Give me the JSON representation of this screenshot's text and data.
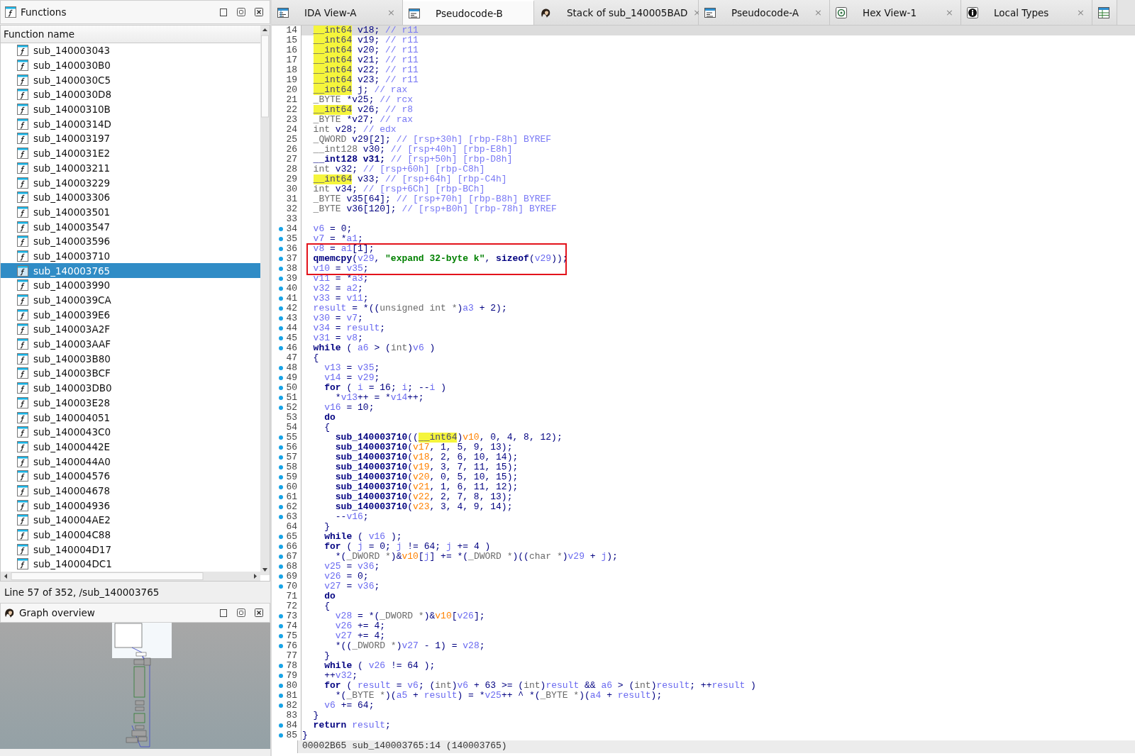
{
  "functions_panel": {
    "title": "Functions",
    "column": "Function name",
    "items": [
      {
        "name": "sub_140003043",
        "selected": false
      },
      {
        "name": "sub_1400030B0",
        "selected": false
      },
      {
        "name": "sub_1400030C5",
        "selected": false
      },
      {
        "name": "sub_1400030D8",
        "selected": false
      },
      {
        "name": "sub_14000310B",
        "selected": false
      },
      {
        "name": "sub_14000314D",
        "selected": false
      },
      {
        "name": "sub_140003197",
        "selected": false
      },
      {
        "name": "sub_1400031E2",
        "selected": false
      },
      {
        "name": "sub_140003211",
        "selected": false
      },
      {
        "name": "sub_140003229",
        "selected": false
      },
      {
        "name": "sub_140003306",
        "selected": false
      },
      {
        "name": "sub_140003501",
        "selected": false
      },
      {
        "name": "sub_140003547",
        "selected": false
      },
      {
        "name": "sub_140003596",
        "selected": false
      },
      {
        "name": "sub_140003710",
        "selected": false
      },
      {
        "name": "sub_140003765",
        "selected": true
      },
      {
        "name": "sub_140003990",
        "selected": false
      },
      {
        "name": "sub_1400039CA",
        "selected": false
      },
      {
        "name": "sub_1400039E6",
        "selected": false
      },
      {
        "name": "sub_140003A2F",
        "selected": false
      },
      {
        "name": "sub_140003AAF",
        "selected": false
      },
      {
        "name": "sub_140003B80",
        "selected": false
      },
      {
        "name": "sub_140003BCF",
        "selected": false
      },
      {
        "name": "sub_140003DB0",
        "selected": false
      },
      {
        "name": "sub_140003E28",
        "selected": false
      },
      {
        "name": "sub_140004051",
        "selected": false
      },
      {
        "name": "sub_1400043C0",
        "selected": false
      },
      {
        "name": "sub_14000442E",
        "selected": false
      },
      {
        "name": "sub_1400044A0",
        "selected": false
      },
      {
        "name": "sub_140004576",
        "selected": false
      },
      {
        "name": "sub_140004678",
        "selected": false
      },
      {
        "name": "sub_140004936",
        "selected": false
      },
      {
        "name": "sub_140004AE2",
        "selected": false
      },
      {
        "name": "sub_140004C88",
        "selected": false
      },
      {
        "name": "sub_140004D17",
        "selected": false
      },
      {
        "name": "sub_140004DC1",
        "selected": false
      }
    ],
    "status": "Line 57 of 352, /sub_140003765"
  },
  "graph_panel": {
    "title": "Graph overview"
  },
  "tabs": [
    {
      "kind": "disasm",
      "label": "IDA View-A",
      "selected": false,
      "close": "×"
    },
    {
      "kind": "pseudocode",
      "label": "Pseudocode-B",
      "selected": true
    },
    {
      "kind": "stack",
      "label": "Stack of sub_140005BAD",
      "selected": false,
      "close": "×"
    },
    {
      "kind": "pseudocode",
      "label": "Pseudocode-A",
      "selected": false,
      "close": "×"
    },
    {
      "kind": "hex",
      "label": "Hex View-1",
      "selected": false,
      "close": "×"
    },
    {
      "kind": "types",
      "label": "Local Types",
      "selected": false,
      "close": "×"
    },
    {
      "kind": "extra",
      "selected": false
    }
  ],
  "code": {
    "lines": [
      {
        "number": "14",
        "dot": false,
        "current": true,
        "boxed": false,
        "tokens": [
          {
            "kind": "hltype",
            "text": "  __int64"
          },
          {
            "kind": "plain",
            "text": " v18; "
          },
          {
            "kind": "comment",
            "text": "// r11"
          }
        ]
      },
      {
        "number": "15",
        "dot": false,
        "current": false,
        "boxed": false,
        "tokens": [
          {
            "kind": "hltype",
            "text": "  __int64"
          },
          {
            "kind": "plain",
            "text": " v19; "
          },
          {
            "kind": "comment",
            "text": "// r11"
          }
        ]
      },
      {
        "number": "16",
        "dot": false,
        "current": false,
        "boxed": false,
        "tokens": [
          {
            "kind": "hltype",
            "text": "  __int64"
          },
          {
            "kind": "plain",
            "text": " v20; "
          },
          {
            "kind": "comment",
            "text": "// r11"
          }
        ]
      },
      {
        "number": "17",
        "dot": false,
        "current": false,
        "boxed": false,
        "tokens": [
          {
            "kind": "hltype",
            "text": "  __int64"
          },
          {
            "kind": "plain",
            "text": " v21; "
          },
          {
            "kind": "comment",
            "text": "// r11"
          }
        ]
      },
      {
        "number": "18",
        "dot": false,
        "current": false,
        "boxed": false,
        "tokens": [
          {
            "kind": "hltype",
            "text": "  __int64"
          },
          {
            "kind": "plain",
            "text": " v22; "
          },
          {
            "kind": "comment",
            "text": "// r11"
          }
        ]
      },
      {
        "number": "19",
        "dot": false,
        "current": false,
        "boxed": false,
        "tokens": [
          {
            "kind": "hltype",
            "text": "  __int64"
          },
          {
            "kind": "plain",
            "text": " v23; "
          },
          {
            "kind": "comment",
            "text": "// r11"
          }
        ]
      },
      {
        "number": "20",
        "dot": false,
        "current": false,
        "boxed": false,
        "tokens": [
          {
            "kind": "hltype",
            "text": "  __int64"
          },
          {
            "kind": "plain",
            "text": " j; "
          },
          {
            "kind": "comment",
            "text": "// rax"
          }
        ]
      },
      {
        "number": "21",
        "dot": false,
        "current": false,
        "boxed": false,
        "tokens": [
          {
            "kind": "type",
            "text": "  _BYTE"
          },
          {
            "kind": "plain",
            "text": " *v25; "
          },
          {
            "kind": "comment",
            "text": "// rcx"
          }
        ]
      },
      {
        "number": "22",
        "dot": false,
        "current": false,
        "boxed": false,
        "tokens": [
          {
            "kind": "hltype",
            "text": "  __int64"
          },
          {
            "kind": "plain",
            "text": " v26; "
          },
          {
            "kind": "comment",
            "text": "// r8"
          }
        ]
      },
      {
        "number": "23",
        "dot": false,
        "current": false,
        "boxed": false,
        "tokens": [
          {
            "kind": "type",
            "text": "  _BYTE"
          },
          {
            "kind": "plain",
            "text": " *v27; "
          },
          {
            "kind": "comment",
            "text": "// rax"
          }
        ]
      },
      {
        "number": "24",
        "dot": false,
        "current": false,
        "boxed": false,
        "tokens": [
          {
            "kind": "type",
            "text": "  int"
          },
          {
            "kind": "plain",
            "text": " v28; "
          },
          {
            "kind": "comment",
            "text": "// edx"
          }
        ]
      },
      {
        "number": "25",
        "dot": false,
        "current": false,
        "boxed": false,
        "tokens": [
          {
            "kind": "type",
            "text": "  _QWORD"
          },
          {
            "kind": "plain",
            "text": " v29[2]; "
          },
          {
            "kind": "comment",
            "text": "// [rsp+30h] [rbp-F8h] BYREF"
          }
        ]
      },
      {
        "number": "26",
        "dot": false,
        "current": false,
        "boxed": false,
        "tokens": [
          {
            "kind": "type",
            "text": "  __int128"
          },
          {
            "kind": "plain",
            "text": " v30; "
          },
          {
            "kind": "comment",
            "text": "// [rsp+40h] [rbp-E8h]"
          }
        ]
      },
      {
        "number": "27",
        "dot": false,
        "current": false,
        "boxed": false,
        "tokens": [
          {
            "kind": "keyword",
            "text": "  __int128 v31;"
          },
          {
            "kind": "comment",
            "text": " // [rsp+50h] [rbp-D8h]"
          }
        ]
      },
      {
        "number": "28",
        "dot": false,
        "current": false,
        "boxed": false,
        "tokens": [
          {
            "kind": "type",
            "text": "  int"
          },
          {
            "kind": "plain",
            "text": " v32; "
          },
          {
            "kind": "comment",
            "text": "// [rsp+60h] [rbp-C8h]"
          }
        ]
      },
      {
        "number": "29",
        "dot": false,
        "current": false,
        "boxed": false,
        "tokens": [
          {
            "kind": "hltype",
            "text": "  __int64"
          },
          {
            "kind": "plain",
            "text": " v33; "
          },
          {
            "kind": "comment",
            "text": "// [rsp+64h] [rbp-C4h]"
          }
        ]
      },
      {
        "number": "30",
        "dot": false,
        "current": false,
        "boxed": false,
        "tokens": [
          {
            "kind": "type",
            "text": "  int"
          },
          {
            "kind": "plain",
            "text": " v34; "
          },
          {
            "kind": "comment",
            "text": "// [rsp+6Ch] [rbp-BCh]"
          }
        ]
      },
      {
        "number": "31",
        "dot": false,
        "current": false,
        "boxed": false,
        "tokens": [
          {
            "kind": "type",
            "text": "  _BYTE"
          },
          {
            "kind": "plain",
            "text": " v35[64]; "
          },
          {
            "kind": "comment",
            "text": "// [rsp+70h] [rbp-B8h] BYREF"
          }
        ]
      },
      {
        "number": "32",
        "dot": false,
        "current": false,
        "boxed": false,
        "tokens": [
          {
            "kind": "type",
            "text": "  _BYTE"
          },
          {
            "kind": "plain",
            "text": " v36[120]; "
          },
          {
            "kind": "comment",
            "text": "// [rsp+B0h] [rbp-78h] BYREF"
          }
        ]
      },
      {
        "number": "33",
        "dot": false,
        "current": false,
        "boxed": false
      },
      {
        "number": "34",
        "dot": true,
        "current": false,
        "boxed": false,
        "tokens": [
          {
            "kind": "var",
            "text": "  v6"
          },
          {
            "kind": "plain",
            "text": " = 0;"
          }
        ]
      },
      {
        "number": "35",
        "dot": true,
        "current": false,
        "boxed": false,
        "tokens": [
          {
            "kind": "var",
            "text": "  v7"
          },
          {
            "kind": "plain",
            "text": " = *"
          },
          {
            "kind": "var",
            "text": "a1"
          },
          {
            "kind": "plain",
            "text": ";"
          }
        ]
      },
      {
        "number": "36",
        "dot": true,
        "current": false,
        "boxed": true,
        "tokens": [
          {
            "kind": "var",
            "text": "  v8"
          },
          {
            "kind": "plain",
            "text": " = "
          },
          {
            "kind": "var",
            "text": "a1"
          },
          {
            "kind": "plain",
            "text": "[1];"
          }
        ]
      },
      {
        "number": "37",
        "dot": true,
        "current": false,
        "boxed": true,
        "tokens": [
          {
            "kind": "func",
            "text": "  qmemcpy"
          },
          {
            "kind": "plain",
            "text": "("
          },
          {
            "kind": "var",
            "text": "v29"
          },
          {
            "kind": "plain",
            "text": ", "
          },
          {
            "kind": "string",
            "text": "\"expand 32-byte k\""
          },
          {
            "kind": "plain",
            "text": ", "
          },
          {
            "kind": "keyword",
            "text": "sizeof"
          },
          {
            "kind": "plain",
            "text": "("
          },
          {
            "kind": "var",
            "text": "v29"
          },
          {
            "kind": "plain",
            "text": "));"
          }
        ]
      },
      {
        "number": "38",
        "dot": true,
        "current": false,
        "boxed": true,
        "tokens": [
          {
            "kind": "var",
            "text": "  v10"
          },
          {
            "kind": "plain",
            "text": " = "
          },
          {
            "kind": "var",
            "text": "v35"
          },
          {
            "kind": "plain",
            "text": ";"
          }
        ]
      },
      {
        "number": "39",
        "dot": true,
        "current": false,
        "boxed": false,
        "tokens": [
          {
            "kind": "var",
            "text": "  v11"
          },
          {
            "kind": "plain",
            "text": " = *"
          },
          {
            "kind": "var",
            "text": "a3"
          },
          {
            "kind": "plain",
            "text": ";"
          }
        ]
      },
      {
        "number": "40",
        "dot": true,
        "current": false,
        "boxed": false,
        "tokens": [
          {
            "kind": "var",
            "text": "  v32"
          },
          {
            "kind": "plain",
            "text": " = "
          },
          {
            "kind": "var",
            "text": "a2"
          },
          {
            "kind": "plain",
            "text": ";"
          }
        ]
      },
      {
        "number": "41",
        "dot": true,
        "current": false,
        "boxed": false,
        "tokens": [
          {
            "kind": "var",
            "text": "  v33"
          },
          {
            "kind": "plain",
            "text": " = "
          },
          {
            "kind": "var",
            "text": "v11"
          },
          {
            "kind": "plain",
            "text": ";"
          }
        ]
      },
      {
        "number": "42",
        "dot": true,
        "current": false,
        "boxed": false,
        "tokens": [
          {
            "kind": "var",
            "text": "  result"
          },
          {
            "kind": "plain",
            "text": " = *(("
          },
          {
            "kind": "type",
            "text": "unsigned int *"
          },
          {
            "kind": "plain",
            "text": ")"
          },
          {
            "kind": "var",
            "text": "a3"
          },
          {
            "kind": "plain",
            "text": " + 2);"
          }
        ]
      },
      {
        "number": "43",
        "dot": true,
        "current": false,
        "boxed": false,
        "tokens": [
          {
            "kind": "var",
            "text": "  v30"
          },
          {
            "kind": "plain",
            "text": " = "
          },
          {
            "kind": "var",
            "text": "v7"
          },
          {
            "kind": "plain",
            "text": ";"
          }
        ]
      },
      {
        "number": "44",
        "dot": true,
        "current": false,
        "boxed": false,
        "tokens": [
          {
            "kind": "var",
            "text": "  v34"
          },
          {
            "kind": "plain",
            "text": " = "
          },
          {
            "kind": "var",
            "text": "result"
          },
          {
            "kind": "plain",
            "text": ";"
          }
        ]
      },
      {
        "number": "45",
        "dot": true,
        "current": false,
        "boxed": false,
        "tokens": [
          {
            "kind": "var",
            "text": "  v31"
          },
          {
            "kind": "plain",
            "text": " = "
          },
          {
            "kind": "var",
            "text": "v8"
          },
          {
            "kind": "plain",
            "text": ";"
          }
        ]
      },
      {
        "number": "46",
        "dot": true,
        "current": false,
        "boxed": false,
        "tokens": [
          {
            "kind": "keyword",
            "text": "  while"
          },
          {
            "kind": "plain",
            "text": " ( "
          },
          {
            "kind": "var",
            "text": "a6"
          },
          {
            "kind": "plain",
            "text": " > ("
          },
          {
            "kind": "type",
            "text": "int"
          },
          {
            "kind": "plain",
            "text": ")"
          },
          {
            "kind": "var",
            "text": "v6"
          },
          {
            "kind": "plain",
            "text": " )"
          }
        ]
      },
      {
        "number": "47",
        "dot": false,
        "current": false,
        "boxed": false,
        "tokens": [
          {
            "kind": "plain",
            "text": "  {"
          }
        ]
      },
      {
        "number": "48",
        "dot": true,
        "current": false,
        "boxed": false,
        "tokens": [
          {
            "kind": "var",
            "text": "    v13"
          },
          {
            "kind": "plain",
            "text": " = "
          },
          {
            "kind": "var",
            "text": "v35"
          },
          {
            "kind": "plain",
            "text": ";"
          }
        ]
      },
      {
        "number": "49",
        "dot": true,
        "current": false,
        "boxed": false,
        "tokens": [
          {
            "kind": "var",
            "text": "    v14"
          },
          {
            "kind": "plain",
            "text": " = "
          },
          {
            "kind": "var",
            "text": "v29"
          },
          {
            "kind": "plain",
            "text": ";"
          }
        ]
      },
      {
        "number": "50",
        "dot": true,
        "current": false,
        "boxed": false,
        "tokens": [
          {
            "kind": "keyword",
            "text": "    for"
          },
          {
            "kind": "plain",
            "text": " ( "
          },
          {
            "kind": "var",
            "text": "i"
          },
          {
            "kind": "plain",
            "text": " = 16; "
          },
          {
            "kind": "var",
            "text": "i"
          },
          {
            "kind": "plain",
            "text": "; --"
          },
          {
            "kind": "var",
            "text": "i"
          },
          {
            "kind": "plain",
            "text": " )"
          }
        ]
      },
      {
        "number": "51",
        "dot": true,
        "current": false,
        "boxed": false,
        "tokens": [
          {
            "kind": "plain",
            "text": "      *"
          },
          {
            "kind": "var",
            "text": "v13"
          },
          {
            "kind": "plain",
            "text": "++ = *"
          },
          {
            "kind": "var",
            "text": "v14"
          },
          {
            "kind": "plain",
            "text": "++;"
          }
        ]
      },
      {
        "number": "52",
        "dot": true,
        "current": false,
        "boxed": false,
        "tokens": [
          {
            "kind": "var",
            "text": "    v16"
          },
          {
            "kind": "plain",
            "text": " = 10;"
          }
        ]
      },
      {
        "number": "53",
        "dot": false,
        "current": false,
        "boxed": false,
        "tokens": [
          {
            "kind": "keyword",
            "text": "    do"
          }
        ]
      },
      {
        "number": "54",
        "dot": false,
        "current": false,
        "boxed": false,
        "tokens": [
          {
            "kind": "plain",
            "text": "    {"
          }
        ]
      },
      {
        "number": "55",
        "dot": true,
        "current": false,
        "boxed": false,
        "tokens": [
          {
            "kind": "func",
            "text": "      sub_140003710"
          },
          {
            "kind": "plain",
            "text": "(("
          },
          {
            "kind": "hltype",
            "text": "__int64"
          },
          {
            "kind": "plain",
            "text": ")"
          },
          {
            "kind": "arg",
            "text": "v10"
          },
          {
            "kind": "plain",
            "text": ", 0, 4, 8, 12);"
          }
        ]
      },
      {
        "number": "56",
        "dot": true,
        "current": false,
        "boxed": false,
        "tokens": [
          {
            "kind": "func",
            "text": "      sub_140003710"
          },
          {
            "kind": "plain",
            "text": "("
          },
          {
            "kind": "arg",
            "text": "v17"
          },
          {
            "kind": "plain",
            "text": ", 1, 5, 9, 13);"
          }
        ]
      },
      {
        "number": "57",
        "dot": true,
        "current": false,
        "boxed": false,
        "tokens": [
          {
            "kind": "func",
            "text": "      sub_140003710"
          },
          {
            "kind": "plain",
            "text": "("
          },
          {
            "kind": "arg",
            "text": "v18"
          },
          {
            "kind": "plain",
            "text": ", 2, 6, 10, 14);"
          }
        ]
      },
      {
        "number": "58",
        "dot": true,
        "current": false,
        "boxed": false,
        "tokens": [
          {
            "kind": "func",
            "text": "      sub_140003710"
          },
          {
            "kind": "plain",
            "text": "("
          },
          {
            "kind": "arg",
            "text": "v19"
          },
          {
            "kind": "plain",
            "text": ", 3, 7, 11, 15);"
          }
        ]
      },
      {
        "number": "59",
        "dot": true,
        "current": false,
        "boxed": false,
        "tokens": [
          {
            "kind": "func",
            "text": "      sub_140003710"
          },
          {
            "kind": "plain",
            "text": "("
          },
          {
            "kind": "arg",
            "text": "v20"
          },
          {
            "kind": "plain",
            "text": ", 0, 5, 10, 15);"
          }
        ]
      },
      {
        "number": "60",
        "dot": true,
        "current": false,
        "boxed": false,
        "tokens": [
          {
            "kind": "func",
            "text": "      sub_140003710"
          },
          {
            "kind": "plain",
            "text": "("
          },
          {
            "kind": "arg",
            "text": "v21"
          },
          {
            "kind": "plain",
            "text": ", 1, 6, 11, 12);"
          }
        ]
      },
      {
        "number": "61",
        "dot": true,
        "current": false,
        "boxed": false,
        "tokens": [
          {
            "kind": "func",
            "text": "      sub_140003710"
          },
          {
            "kind": "plain",
            "text": "("
          },
          {
            "kind": "arg",
            "text": "v22"
          },
          {
            "kind": "plain",
            "text": ", 2, 7, 8, 13);"
          }
        ]
      },
      {
        "number": "62",
        "dot": true,
        "current": false,
        "boxed": false,
        "tokens": [
          {
            "kind": "func",
            "text": "      sub_140003710"
          },
          {
            "kind": "plain",
            "text": "("
          },
          {
            "kind": "arg",
            "text": "v23"
          },
          {
            "kind": "plain",
            "text": ", 3, 4, 9, 14);"
          }
        ]
      },
      {
        "number": "63",
        "dot": true,
        "current": false,
        "boxed": false,
        "tokens": [
          {
            "kind": "plain",
            "text": "      --"
          },
          {
            "kind": "var",
            "text": "v16"
          },
          {
            "kind": "plain",
            "text": ";"
          }
        ]
      },
      {
        "number": "64",
        "dot": false,
        "current": false,
        "boxed": false,
        "tokens": [
          {
            "kind": "plain",
            "text": "    }"
          }
        ]
      },
      {
        "number": "65",
        "dot": true,
        "current": false,
        "boxed": false,
        "tokens": [
          {
            "kind": "keyword",
            "text": "    while"
          },
          {
            "kind": "plain",
            "text": " ( "
          },
          {
            "kind": "var",
            "text": "v16"
          },
          {
            "kind": "plain",
            "text": " );"
          }
        ]
      },
      {
        "number": "66",
        "dot": true,
        "current": false,
        "boxed": false,
        "tokens": [
          {
            "kind": "keyword",
            "text": "    for"
          },
          {
            "kind": "plain",
            "text": " ( "
          },
          {
            "kind": "var",
            "text": "j"
          },
          {
            "kind": "plain",
            "text": " = 0; "
          },
          {
            "kind": "var",
            "text": "j"
          },
          {
            "kind": "plain",
            "text": " != 64; "
          },
          {
            "kind": "var",
            "text": "j"
          },
          {
            "kind": "plain",
            "text": " += 4 )"
          }
        ]
      },
      {
        "number": "67",
        "dot": true,
        "current": false,
        "boxed": false,
        "tokens": [
          {
            "kind": "plain",
            "text": "      *("
          },
          {
            "kind": "type",
            "text": "_DWORD *"
          },
          {
            "kind": "plain",
            "text": ")&"
          },
          {
            "kind": "arg",
            "text": "v10"
          },
          {
            "kind": "plain",
            "text": "["
          },
          {
            "kind": "var",
            "text": "j"
          },
          {
            "kind": "plain",
            "text": "] += *("
          },
          {
            "kind": "type",
            "text": "_DWORD *"
          },
          {
            "kind": "plain",
            "text": ")(("
          },
          {
            "kind": "type",
            "text": "char *"
          },
          {
            "kind": "plain",
            "text": ")"
          },
          {
            "kind": "var",
            "text": "v29"
          },
          {
            "kind": "plain",
            "text": " + "
          },
          {
            "kind": "var",
            "text": "j"
          },
          {
            "kind": "plain",
            "text": ");"
          }
        ]
      },
      {
        "number": "68",
        "dot": true,
        "current": false,
        "boxed": false,
        "tokens": [
          {
            "kind": "var",
            "text": "    v25"
          },
          {
            "kind": "plain",
            "text": " = "
          },
          {
            "kind": "var",
            "text": "v36"
          },
          {
            "kind": "plain",
            "text": ";"
          }
        ]
      },
      {
        "number": "69",
        "dot": true,
        "current": false,
        "boxed": false,
        "tokens": [
          {
            "kind": "var",
            "text": "    v26"
          },
          {
            "kind": "plain",
            "text": " = 0;"
          }
        ]
      },
      {
        "number": "70",
        "dot": true,
        "current": false,
        "boxed": false,
        "tokens": [
          {
            "kind": "var",
            "text": "    v27"
          },
          {
            "kind": "plain",
            "text": " = "
          },
          {
            "kind": "var",
            "text": "v36"
          },
          {
            "kind": "plain",
            "text": ";"
          }
        ]
      },
      {
        "number": "71",
        "dot": false,
        "current": false,
        "boxed": false,
        "tokens": [
          {
            "kind": "keyword",
            "text": "    do"
          }
        ]
      },
      {
        "number": "72",
        "dot": false,
        "current": false,
        "boxed": false,
        "tokens": [
          {
            "kind": "plain",
            "text": "    {"
          }
        ]
      },
      {
        "number": "73",
        "dot": true,
        "current": false,
        "boxed": false,
        "tokens": [
          {
            "kind": "var",
            "text": "      v28"
          },
          {
            "kind": "plain",
            "text": " = *("
          },
          {
            "kind": "type",
            "text": "_DWORD *"
          },
          {
            "kind": "plain",
            "text": ")&"
          },
          {
            "kind": "arg",
            "text": "v10"
          },
          {
            "kind": "plain",
            "text": "["
          },
          {
            "kind": "var",
            "text": "v26"
          },
          {
            "kind": "plain",
            "text": "];"
          }
        ]
      },
      {
        "number": "74",
        "dot": true,
        "current": false,
        "boxed": false,
        "tokens": [
          {
            "kind": "var",
            "text": "      v26"
          },
          {
            "kind": "plain",
            "text": " += 4;"
          }
        ]
      },
      {
        "number": "75",
        "dot": true,
        "current": false,
        "boxed": false,
        "tokens": [
          {
            "kind": "var",
            "text": "      v27"
          },
          {
            "kind": "plain",
            "text": " += 4;"
          }
        ]
      },
      {
        "number": "76",
        "dot": true,
        "current": false,
        "boxed": false,
        "tokens": [
          {
            "kind": "plain",
            "text": "      *(("
          },
          {
            "kind": "type",
            "text": "_DWORD *"
          },
          {
            "kind": "plain",
            "text": ")"
          },
          {
            "kind": "var",
            "text": "v27"
          },
          {
            "kind": "plain",
            "text": " - 1) = "
          },
          {
            "kind": "var",
            "text": "v28"
          },
          {
            "kind": "plain",
            "text": ";"
          }
        ]
      },
      {
        "number": "77",
        "dot": false,
        "current": false,
        "boxed": false,
        "tokens": [
          {
            "kind": "plain",
            "text": "    }"
          }
        ]
      },
      {
        "number": "78",
        "dot": true,
        "current": false,
        "boxed": false,
        "tokens": [
          {
            "kind": "keyword",
            "text": "    while"
          },
          {
            "kind": "plain",
            "text": " ( "
          },
          {
            "kind": "var",
            "text": "v26"
          },
          {
            "kind": "plain",
            "text": " != 64 );"
          }
        ]
      },
      {
        "number": "79",
        "dot": true,
        "current": false,
        "boxed": false,
        "tokens": [
          {
            "kind": "plain",
            "text": "    ++"
          },
          {
            "kind": "var",
            "text": "v32"
          },
          {
            "kind": "plain",
            "text": ";"
          }
        ]
      },
      {
        "number": "80",
        "dot": true,
        "current": false,
        "boxed": false,
        "tokens": [
          {
            "kind": "keyword",
            "text": "    for"
          },
          {
            "kind": "plain",
            "text": " ( "
          },
          {
            "kind": "var",
            "text": "result"
          },
          {
            "kind": "plain",
            "text": " = "
          },
          {
            "kind": "var",
            "text": "v6"
          },
          {
            "kind": "plain",
            "text": "; ("
          },
          {
            "kind": "type",
            "text": "int"
          },
          {
            "kind": "plain",
            "text": ")"
          },
          {
            "kind": "var",
            "text": "v6"
          },
          {
            "kind": "plain",
            "text": " + 63 >= ("
          },
          {
            "kind": "type",
            "text": "int"
          },
          {
            "kind": "plain",
            "text": ")"
          },
          {
            "kind": "var",
            "text": "result"
          },
          {
            "kind": "plain",
            "text": " && "
          },
          {
            "kind": "var",
            "text": "a6"
          },
          {
            "kind": "plain",
            "text": " > ("
          },
          {
            "kind": "type",
            "text": "int"
          },
          {
            "kind": "plain",
            "text": ")"
          },
          {
            "kind": "var",
            "text": "result"
          },
          {
            "kind": "plain",
            "text": "; ++"
          },
          {
            "kind": "var",
            "text": "result"
          },
          {
            "kind": "plain",
            "text": " )"
          }
        ]
      },
      {
        "number": "81",
        "dot": true,
        "current": false,
        "boxed": false,
        "tokens": [
          {
            "kind": "plain",
            "text": "      *("
          },
          {
            "kind": "type",
            "text": "_BYTE *"
          },
          {
            "kind": "plain",
            "text": ")("
          },
          {
            "kind": "var",
            "text": "a5"
          },
          {
            "kind": "plain",
            "text": " + "
          },
          {
            "kind": "var",
            "text": "result"
          },
          {
            "kind": "plain",
            "text": ") = *"
          },
          {
            "kind": "var",
            "text": "v25"
          },
          {
            "kind": "plain",
            "text": "++ ^ *("
          },
          {
            "kind": "type",
            "text": "_BYTE *"
          },
          {
            "kind": "plain",
            "text": ")("
          },
          {
            "kind": "var",
            "text": "a4"
          },
          {
            "kind": "plain",
            "text": " + "
          },
          {
            "kind": "var",
            "text": "result"
          },
          {
            "kind": "plain",
            "text": ");"
          }
        ]
      },
      {
        "number": "82",
        "dot": true,
        "current": false,
        "boxed": false,
        "tokens": [
          {
            "kind": "var",
            "text": "    v6"
          },
          {
            "kind": "plain",
            "text": " += 64;"
          }
        ]
      },
      {
        "number": "83",
        "dot": false,
        "current": false,
        "boxed": false,
        "tokens": [
          {
            "kind": "plain",
            "text": "  }"
          }
        ]
      },
      {
        "number": "84",
        "dot": true,
        "current": false,
        "boxed": false,
        "tokens": [
          {
            "kind": "keyword",
            "text": "  return"
          },
          {
            "kind": "var",
            "text": " result"
          },
          {
            "kind": "plain",
            "text": ";"
          }
        ]
      },
      {
        "number": "85",
        "dot": true,
        "current": false,
        "boxed": false,
        "tokens": [
          {
            "kind": "plain",
            "text": "}"
          }
        ]
      }
    ],
    "status": "00002B65 sub_140003765:14 (140003765)"
  }
}
